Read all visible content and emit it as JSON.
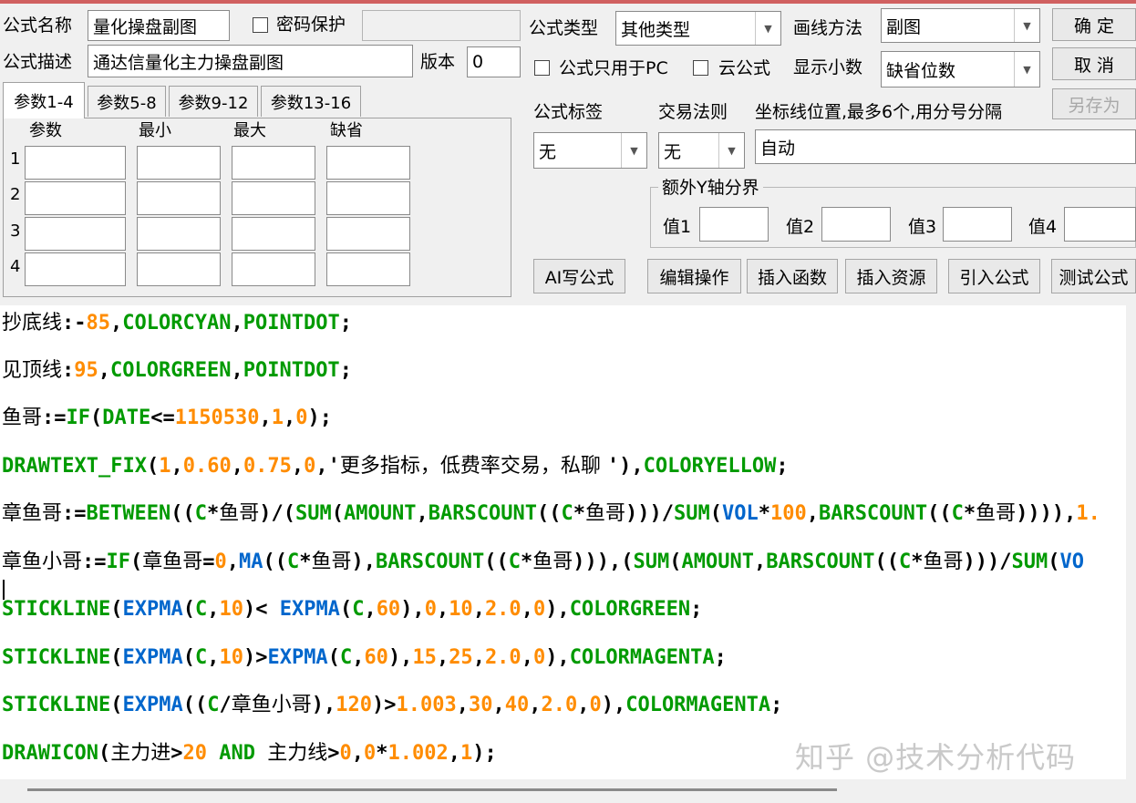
{
  "form": {
    "name_label": "公式名称",
    "name_value": "量化操盘副图",
    "password_label": "密码保护",
    "desc_label": "公式描述",
    "desc_value": "通达信量化主力操盘副图",
    "version_label": "版本",
    "version_value": "0",
    "type_label": "公式类型",
    "type_value": "其他类型",
    "draw_label": "画线方法",
    "draw_value": "副图",
    "pc_only_label": "公式只用于PC",
    "cloud_label": "云公式",
    "decimals_label": "显示小数",
    "decimals_value": "缺省位数",
    "tag_label": "公式标签",
    "tag_value": "无",
    "trade_label": "交易法则",
    "trade_value": "无",
    "coord_label": "坐标线位置,最多6个,用分号分隔",
    "coord_value": "自动",
    "yaxis_title": "额外Y轴分界",
    "y_values": [
      "值1",
      "值2",
      "值3",
      "值4"
    ]
  },
  "buttons": {
    "ok": "确  定",
    "cancel": "取  消",
    "save_as": "另存为",
    "ai": "AI写公式",
    "edit": "编辑操作",
    "insert_func": "插入函数",
    "insert_res": "插入资源",
    "import": "引入公式",
    "test": "测试公式"
  },
  "tabs": [
    "参数1-4",
    "参数5-8",
    "参数9-12",
    "参数13-16"
  ],
  "params": {
    "headers": [
      "参数",
      "最小",
      "最大",
      "缺省"
    ],
    "rows": [
      "1",
      "2",
      "3",
      "4"
    ]
  },
  "code_lines": [
    [
      [
        "cjk",
        "抄底线"
      ],
      [
        "k",
        ":-"
      ],
      [
        "o",
        "85"
      ],
      [
        "k",
        ","
      ],
      [
        "g",
        "COLORCYAN"
      ],
      [
        "k",
        ","
      ],
      [
        "g",
        "POINTDOT"
      ],
      [
        "k",
        ";"
      ]
    ],
    [
      [
        "cjk",
        "见顶线"
      ],
      [
        "k",
        ":"
      ],
      [
        "o",
        "95"
      ],
      [
        "k",
        ","
      ],
      [
        "g",
        "COLORGREEN"
      ],
      [
        "k",
        ","
      ],
      [
        "g",
        "POINTDOT"
      ],
      [
        "k",
        ";"
      ]
    ],
    [
      [
        "cjk",
        "鱼哥"
      ],
      [
        "k",
        ":="
      ],
      [
        "g",
        "IF"
      ],
      [
        "k",
        "("
      ],
      [
        "g",
        "DATE"
      ],
      [
        "k",
        "<="
      ],
      [
        "o",
        "1150530"
      ],
      [
        "k",
        ","
      ],
      [
        "o",
        "1"
      ],
      [
        "k",
        ","
      ],
      [
        "o",
        "0"
      ],
      [
        "k",
        ");"
      ]
    ],
    [
      [
        "g",
        "DRAWTEXT_FIX"
      ],
      [
        "k",
        "("
      ],
      [
        "o",
        "1"
      ],
      [
        "k",
        ","
      ],
      [
        "o",
        "0.60"
      ],
      [
        "k",
        ","
      ],
      [
        "o",
        "0.75"
      ],
      [
        "k",
        ","
      ],
      [
        "o",
        "0"
      ],
      [
        "k",
        ",'"
      ],
      [
        "cjk",
        "更多指标，低费率交易，私聊 "
      ],
      [
        "k",
        "'),"
      ],
      [
        "g",
        "COLORYELLOW"
      ],
      [
        "k",
        ";"
      ]
    ],
    [
      [
        "cjk",
        "章鱼哥"
      ],
      [
        "k",
        ":="
      ],
      [
        "g",
        "BETWEEN"
      ],
      [
        "k",
        "(("
      ],
      [
        "g",
        "C"
      ],
      [
        "k",
        "*"
      ],
      [
        "cjk",
        "鱼哥"
      ],
      [
        "k",
        ")/("
      ],
      [
        "g",
        "SUM"
      ],
      [
        "k",
        "("
      ],
      [
        "g",
        "AMOUNT"
      ],
      [
        "k",
        ","
      ],
      [
        "g",
        "BARSCOUNT"
      ],
      [
        "k",
        "(("
      ],
      [
        "g",
        "C"
      ],
      [
        "k",
        "*"
      ],
      [
        "cjk",
        "鱼哥"
      ],
      [
        "k",
        ")))/"
      ],
      [
        "g",
        "SUM"
      ],
      [
        "k",
        "("
      ],
      [
        "b",
        "VOL"
      ],
      [
        "k",
        "*"
      ],
      [
        "o",
        "100"
      ],
      [
        "k",
        ","
      ],
      [
        "g",
        "BARSCOUNT"
      ],
      [
        "k",
        "(("
      ],
      [
        "g",
        "C"
      ],
      [
        "k",
        "*"
      ],
      [
        "cjk",
        "鱼哥"
      ],
      [
        "k",
        "))))"
      ],
      [
        "k",
        ","
      ],
      [
        "o",
        "1."
      ]
    ],
    [
      [
        "cjk",
        "章鱼小哥"
      ],
      [
        "k",
        ":="
      ],
      [
        "g",
        "IF"
      ],
      [
        "k",
        "("
      ],
      [
        "cjk",
        "章鱼哥"
      ],
      [
        "k",
        "="
      ],
      [
        "o",
        "0"
      ],
      [
        "k",
        ","
      ],
      [
        "b",
        "MA"
      ],
      [
        "k",
        "(("
      ],
      [
        "g",
        "C"
      ],
      [
        "k",
        "*"
      ],
      [
        "cjk",
        "鱼哥"
      ],
      [
        "k",
        "),"
      ],
      [
        "g",
        "BARSCOUNT"
      ],
      [
        "k",
        "(("
      ],
      [
        "g",
        "C"
      ],
      [
        "k",
        "*"
      ],
      [
        "cjk",
        "鱼哥"
      ],
      [
        "k",
        ")))"
      ],
      [
        "k",
        ",("
      ],
      [
        "g",
        "SUM"
      ],
      [
        "k",
        "("
      ],
      [
        "g",
        "AMOUNT"
      ],
      [
        "k",
        ","
      ],
      [
        "g",
        "BARSCOUNT"
      ],
      [
        "k",
        "(("
      ],
      [
        "g",
        "C"
      ],
      [
        "k",
        "*"
      ],
      [
        "cjk",
        "鱼哥"
      ],
      [
        "k",
        ")))/"
      ],
      [
        "g",
        "SUM"
      ],
      [
        "k",
        "("
      ],
      [
        "b",
        "VO"
      ]
    ],
    [
      [
        "g",
        "STICKLINE"
      ],
      [
        "k",
        "("
      ],
      [
        "b",
        "EXPMA"
      ],
      [
        "k",
        "("
      ],
      [
        "g",
        "C"
      ],
      [
        "k",
        ","
      ],
      [
        "o",
        "10"
      ],
      [
        "k",
        ")< "
      ],
      [
        "b",
        "EXPMA"
      ],
      [
        "k",
        "("
      ],
      [
        "g",
        "C"
      ],
      [
        "k",
        ","
      ],
      [
        "o",
        "60"
      ],
      [
        "k",
        "),"
      ],
      [
        "o",
        "0"
      ],
      [
        "k",
        ","
      ],
      [
        "o",
        "10"
      ],
      [
        "k",
        ","
      ],
      [
        "o",
        "2.0"
      ],
      [
        "k",
        ","
      ],
      [
        "o",
        "0"
      ],
      [
        "k",
        "),"
      ],
      [
        "g",
        "COLORGREEN"
      ],
      [
        "k",
        ";"
      ]
    ],
    [
      [
        "g",
        "STICKLINE"
      ],
      [
        "k",
        "("
      ],
      [
        "b",
        "EXPMA"
      ],
      [
        "k",
        "("
      ],
      [
        "g",
        "C"
      ],
      [
        "k",
        ","
      ],
      [
        "o",
        "10"
      ],
      [
        "k",
        ")>"
      ],
      [
        "b",
        "EXPMA"
      ],
      [
        "k",
        "("
      ],
      [
        "g",
        "C"
      ],
      [
        "k",
        ","
      ],
      [
        "o",
        "60"
      ],
      [
        "k",
        "),"
      ],
      [
        "o",
        "15"
      ],
      [
        "k",
        ","
      ],
      [
        "o",
        "25"
      ],
      [
        "k",
        ","
      ],
      [
        "o",
        "2.0"
      ],
      [
        "k",
        ","
      ],
      [
        "o",
        "0"
      ],
      [
        "k",
        "),"
      ],
      [
        "g",
        "COLORMAGENTA"
      ],
      [
        "k",
        ";"
      ]
    ],
    [
      [
        "g",
        "STICKLINE"
      ],
      [
        "k",
        "("
      ],
      [
        "b",
        "EXPMA"
      ],
      [
        "k",
        "(("
      ],
      [
        "g",
        "C"
      ],
      [
        "k",
        "/"
      ],
      [
        "cjk",
        "章鱼小哥"
      ],
      [
        "k",
        "),"
      ],
      [
        "o",
        "120"
      ],
      [
        "k",
        ")>"
      ],
      [
        "o",
        "1.003"
      ],
      [
        "k",
        ","
      ],
      [
        "o",
        "30"
      ],
      [
        "k",
        ","
      ],
      [
        "o",
        "40"
      ],
      [
        "k",
        ","
      ],
      [
        "o",
        "2.0"
      ],
      [
        "k",
        ","
      ],
      [
        "o",
        "0"
      ],
      [
        "k",
        "),"
      ],
      [
        "g",
        "COLORMAGENTA"
      ],
      [
        "k",
        ";"
      ]
    ],
    [
      [
        "g",
        "DRAWICON"
      ],
      [
        "k",
        "("
      ],
      [
        "cjk",
        "主力进"
      ],
      [
        "k",
        ">"
      ],
      [
        "o",
        "20"
      ],
      [
        "k",
        " "
      ],
      [
        "g",
        "AND"
      ],
      [
        "k",
        " "
      ],
      [
        "cjk",
        "主力线"
      ],
      [
        "k",
        ">"
      ],
      [
        "o",
        "0"
      ],
      [
        "k",
        ","
      ],
      [
        "o",
        "0"
      ],
      [
        "k",
        "*"
      ],
      [
        "o",
        "1.002"
      ],
      [
        "k",
        ","
      ],
      [
        "o",
        "1"
      ],
      [
        "k",
        ");"
      ]
    ]
  ],
  "watermark": "知乎 @技术分析代码"
}
